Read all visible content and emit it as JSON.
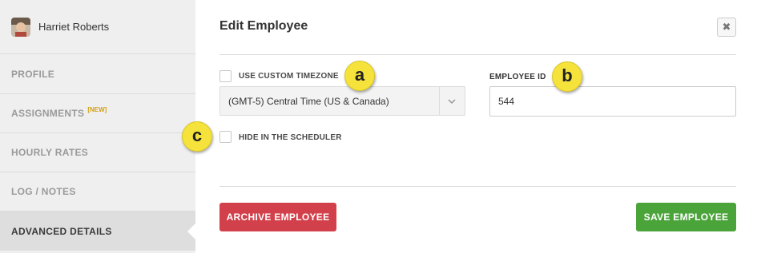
{
  "user": {
    "name": "Harriet Roberts"
  },
  "sidebar": {
    "items": [
      {
        "label": "PROFILE",
        "badge": ""
      },
      {
        "label": "ASSIGNMENTS",
        "badge": "[NEW]"
      },
      {
        "label": "HOURLY RATES",
        "badge": ""
      },
      {
        "label": "LOG / NOTES",
        "badge": ""
      },
      {
        "label": "ADVANCED DETAILS",
        "badge": "",
        "active": true
      }
    ]
  },
  "dialog": {
    "title": "Edit Employee",
    "close_icon": "close-icon"
  },
  "form": {
    "custom_timezone": {
      "label": "USE CUSTOM TIMEZONE",
      "checked": false
    },
    "timezone_select": {
      "value": "(GMT-5) Central Time (US & Canada)"
    },
    "employee_id": {
      "label": "EMPLOYEE ID",
      "value": "544"
    },
    "hide_in_scheduler": {
      "label": "HIDE IN THE SCHEDULER",
      "checked": false
    }
  },
  "markers": {
    "a": "a",
    "b": "b",
    "c": "c"
  },
  "buttons": {
    "archive": "ARCHIVE EMPLOYEE",
    "save": "SAVE EMPLOYEE"
  },
  "colors": {
    "marker": "#f5e23a",
    "archive": "#d2404b",
    "save": "#4ba43a",
    "badge": "#d4a017"
  }
}
